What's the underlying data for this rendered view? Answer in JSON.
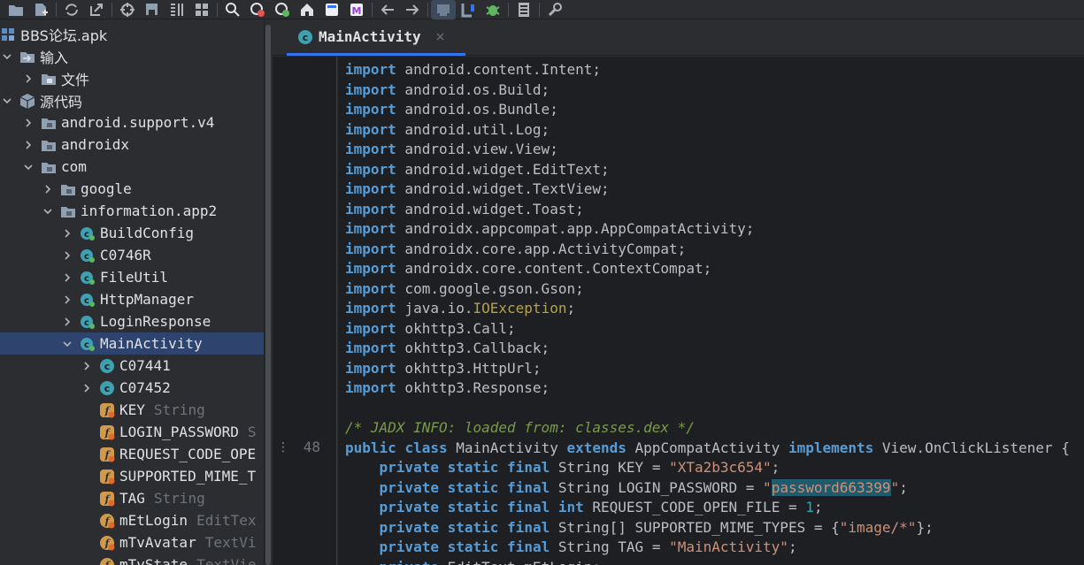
{
  "toolbar": {
    "icons": [
      "open-folder-icon",
      "add-file-icon",
      "sync-icon",
      "export-icon",
      "crosshair-icon",
      "save-all-icon",
      "layout-icon",
      "grid-icon",
      "search-icon",
      "find-usages-icon",
      "find-replace-icon",
      "home-icon",
      "smali-icon",
      "markdown-icon",
      "back-icon",
      "forward-icon",
      "decompile-icon",
      "quark-icon",
      "debug-bug-icon",
      "log-icon",
      "settings-wrench-icon"
    ],
    "markdown_letter": "M"
  },
  "sidebar": {
    "items": [
      {
        "label": "BBS论坛.apk",
        "type": "",
        "kind": "apk"
      },
      {
        "label": "输入",
        "type": "",
        "kind": "folder-input"
      },
      {
        "label": "文件",
        "type": "",
        "kind": "folder"
      },
      {
        "label": "源代码",
        "type": "",
        "kind": "package-root"
      },
      {
        "label": "android.support.v4",
        "type": "",
        "kind": "package"
      },
      {
        "label": "androidx",
        "type": "",
        "kind": "package"
      },
      {
        "label": "com",
        "type": "",
        "kind": "package"
      },
      {
        "label": "google",
        "type": "",
        "kind": "package"
      },
      {
        "label": "information.app2",
        "type": "",
        "kind": "package"
      },
      {
        "label": "BuildConfig",
        "type": "",
        "kind": "class"
      },
      {
        "label": "C0746R",
        "type": "",
        "kind": "class"
      },
      {
        "label": "FileUtil",
        "type": "",
        "kind": "class"
      },
      {
        "label": "HttpManager",
        "type": "",
        "kind": "class"
      },
      {
        "label": "LoginResponse",
        "type": "",
        "kind": "class"
      },
      {
        "label": "MainActivity",
        "type": "",
        "kind": "class"
      },
      {
        "label": "C07441",
        "type": "",
        "kind": "inner-class"
      },
      {
        "label": "C07452",
        "type": "",
        "kind": "inner-class"
      },
      {
        "label": "KEY",
        "type": "String",
        "kind": "static-field"
      },
      {
        "label": "LOGIN_PASSWORD",
        "type": "S",
        "kind": "static-field"
      },
      {
        "label": "REQUEST_CODE_OPE",
        "type": "",
        "kind": "static-field"
      },
      {
        "label": "SUPPORTED_MIME_T",
        "type": "",
        "kind": "static-field"
      },
      {
        "label": "TAG",
        "type": "String",
        "kind": "static-field"
      },
      {
        "label": "mEtLogin",
        "type": "EditTex",
        "kind": "field"
      },
      {
        "label": "mTvAvatar",
        "type": "TextVi",
        "kind": "field"
      },
      {
        "label": "mTvState",
        "type": "TextVie",
        "kind": "field"
      }
    ]
  },
  "editor": {
    "tab_label": "MainActivity",
    "tab_close": "×",
    "line_number": "48",
    "fold_marker": "⋮",
    "imports": [
      "android.content.Intent",
      "android.os.Build",
      "android.os.Bundle",
      "android.util.Log",
      "android.view.View",
      "android.widget.EditText",
      "android.widget.TextView",
      "android.widget.Toast",
      "androidx.appcompat.app.AppCompatActivity",
      "androidx.core.app.ActivityCompat",
      "androidx.core.content.ContextCompat",
      "com.google.gson.Gson",
      "java.io.IOException",
      "okhttp3.Call",
      "okhttp3.Callback",
      "okhttp3.HttpUrl",
      "okhttp3.Response"
    ],
    "import_keyword": "import",
    "comment": "/* JADX INFO: loaded from: classes.dex */",
    "class_decl": {
      "public": "public",
      "class": "class",
      "name": "MainActivity",
      "extends": "extends",
      "parent": "AppCompatActivity",
      "implements": "implements",
      "iface": "View.OnClickListener"
    },
    "fields": {
      "key_value": "\"XTa2b3c654\"",
      "password_open": "\"",
      "password_value": "password663399",
      "password_close": "\"",
      "request_code_value": "1",
      "mime_value": "\"image/*\"",
      "tag_value": "\"MainActivity\""
    },
    "last_line": "private EditText mEtLogin;"
  }
}
